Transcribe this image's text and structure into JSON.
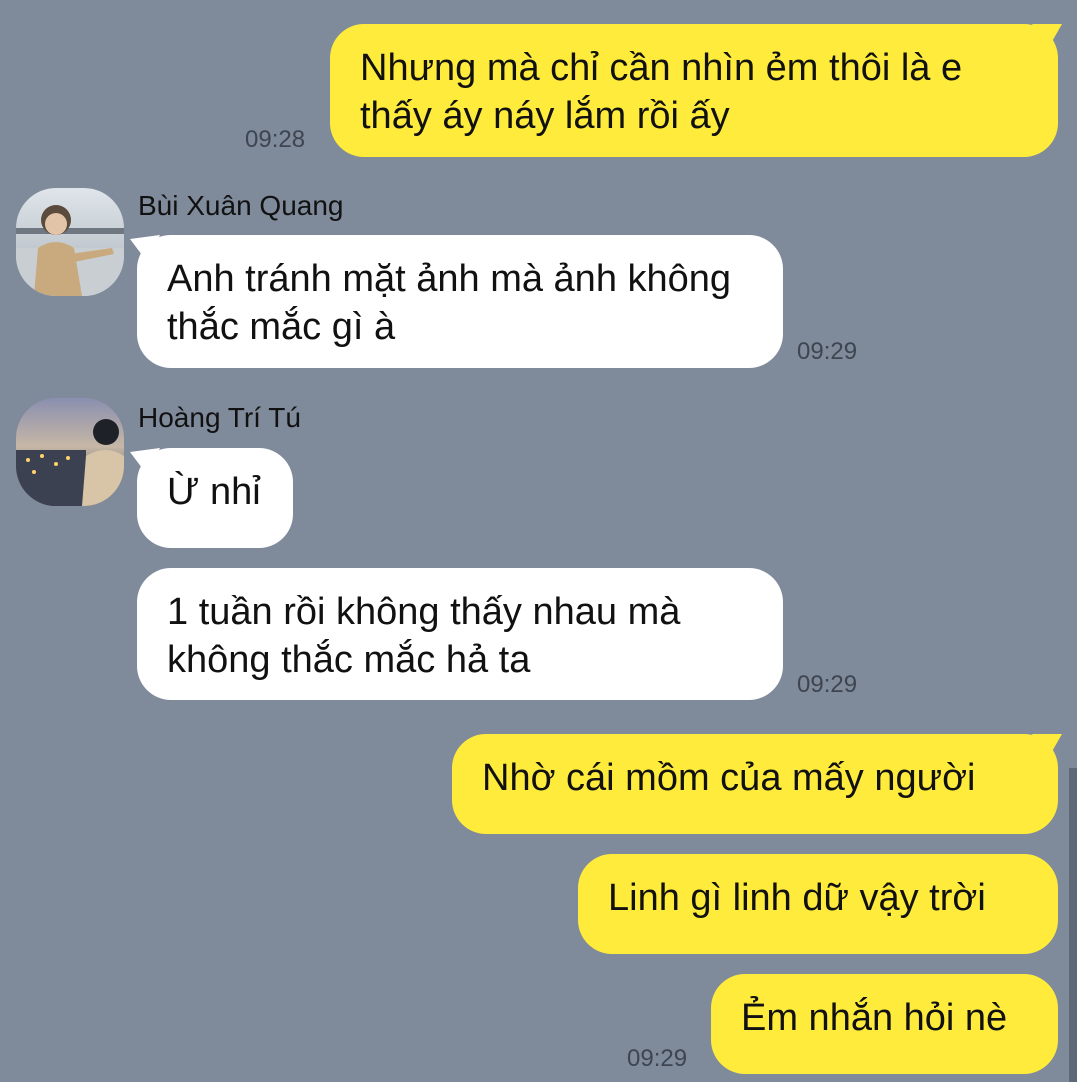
{
  "messages": [
    {
      "text": "Nhưng mà chỉ cần nhìn ẻm thôi là e thấy áy náy lắm rồi ấy",
      "time": "09:28",
      "mine": true
    },
    {
      "sender": "Bùi Xuân Quang",
      "text": "Anh tránh mặt ảnh mà ảnh không thắc mắc gì à",
      "time": "09:29"
    },
    {
      "sender": "Hoàng Trí Tú",
      "text": "Ừ nhỉ"
    },
    {
      "text": "1 tuần rồi không thấy nhau mà không thắc mắc hả ta",
      "time": "09:29"
    },
    {
      "text": "Nhờ cái mồm của mấy người",
      "mine": true
    },
    {
      "text": "Linh gì linh dữ vậy trời",
      "mine": true
    },
    {
      "text": "Ẻm nhắn hỏi nè",
      "time": "09:29",
      "mine": true
    }
  ],
  "avatars": [
    {
      "name": "avatar-bui-xuan-quang",
      "icon": "person-photo"
    },
    {
      "name": "avatar-hoang-tri-tu",
      "icon": "person-photo"
    }
  ],
  "colors": {
    "background": "#7f8a9a",
    "my_bubble": "#ffeb3b",
    "their_bubble": "#ffffff",
    "time_text": "#3f4550"
  }
}
